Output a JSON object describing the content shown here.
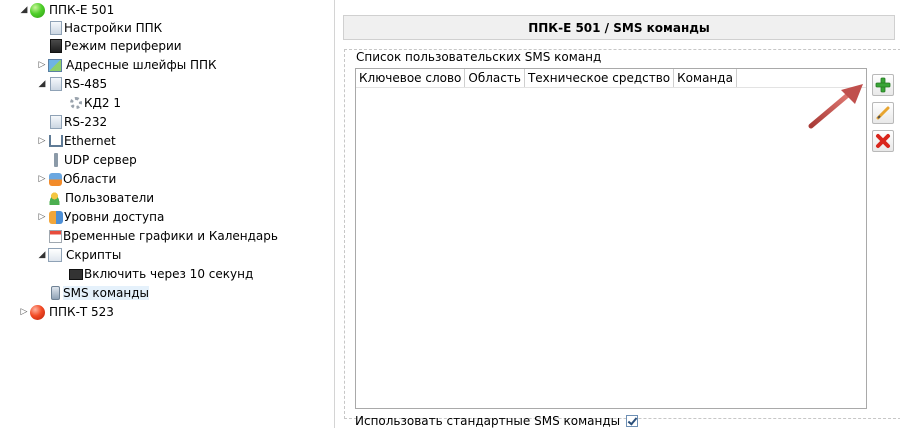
{
  "tree": {
    "nodes": [
      {
        "label": "ППК-Е 501",
        "icon": "green-status-ball-icon"
      },
      {
        "label": "Настройки ППК",
        "icon": "settings-doc-icon"
      },
      {
        "label": "Режим периферии",
        "icon": "dark-doc-icon"
      },
      {
        "label": "Адресные шлейфы ППК",
        "icon": "address-loops-icon"
      },
      {
        "label": "RS-485",
        "icon": "rs485-icon"
      },
      {
        "label": "КД2 1",
        "icon": "gear-icon"
      },
      {
        "label": "RS-232",
        "icon": "rs232-icon"
      },
      {
        "label": "Ethernet",
        "icon": "network-icon"
      },
      {
        "label": "UDP сервер",
        "icon": "udp-server-icon"
      },
      {
        "label": "Области",
        "icon": "areas-icon"
      },
      {
        "label": "Пользователи",
        "icon": "users-icon"
      },
      {
        "label": "Уровни доступа",
        "icon": "access-keys-icon"
      },
      {
        "label": "Временные графики и Календарь",
        "icon": "calendar-icon"
      },
      {
        "label": "Скрипты",
        "icon": "scripts-icon"
      },
      {
        "label": "Включить через 10 секунд",
        "icon": "script-item-icon"
      },
      {
        "label": "SMS команды",
        "icon": "phone-icon"
      },
      {
        "label": "ППК-Т 523",
        "icon": "red-status-ball-icon"
      }
    ]
  },
  "panel": {
    "title": "ППК-Е 501 / SMS команды",
    "group_label": "Список пользовательских SMS команд",
    "columns": [
      "Ключевое слово",
      "Область",
      "Техническое средство",
      "Команда"
    ],
    "std_label": "Использовать стандартные SMS команды",
    "std_checked": true
  },
  "toolbar": {
    "add_icon": "plus-icon",
    "edit_icon": "pencil-icon",
    "delete_icon": "delete-x-icon"
  },
  "colors": {
    "arrow": "#c0504d",
    "add": "#3aa537",
    "delete": "#d9261c"
  }
}
